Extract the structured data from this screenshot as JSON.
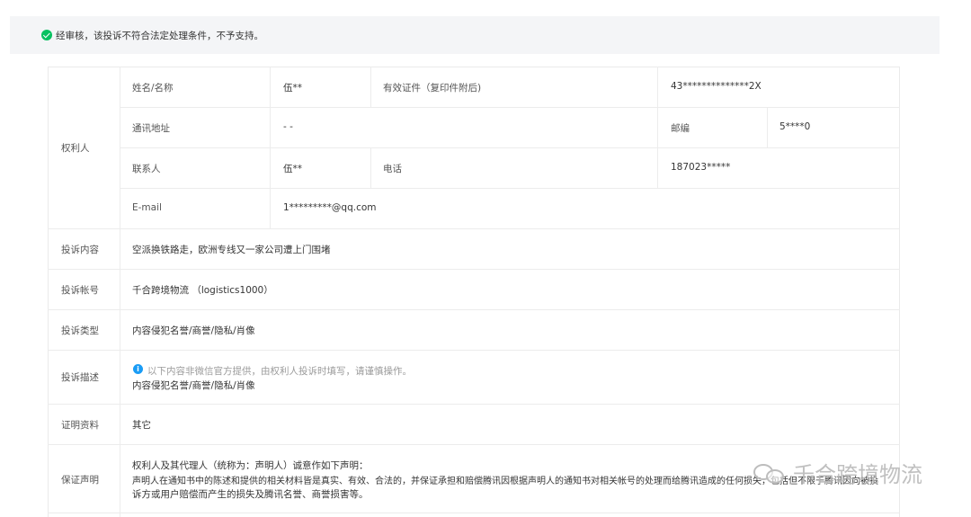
{
  "banner": {
    "message": "经审核，该投诉不符合法定处理条件，不予支持。"
  },
  "rights_holder": {
    "section_label": "权利人",
    "name_label": "姓名/名称",
    "name_value": "伍**",
    "id_label": "有效证件（复印件附后)",
    "id_value": "43**************2X",
    "address_label": "通讯地址",
    "address_value": "- -",
    "zip_label": "邮编",
    "zip_value": "5****0",
    "contact_label": "联系人",
    "contact_value": "伍**",
    "phone_label": "电话",
    "phone_value": "187023*****",
    "email_label": "E-mail",
    "email_value": "1*********@qq.com"
  },
  "complaint": {
    "content_label": "投诉内容",
    "content_value": "空派换铁路走，欧洲专线又一家公司遭上门围堵",
    "account_label": "投诉帐号",
    "account_value": "千合跨境物流 （logistics1000）",
    "type_label": "投诉类型",
    "type_value": "内容侵犯名誉/商誉/隐私/肖像",
    "desc_label": "投诉描述",
    "desc_note": "以下内容非微信官方提供，由权利人投诉时填写，请谨慎操作。",
    "desc_value": "内容侵犯名誉/商誉/隐私/肖像",
    "evidence_label": "证明资料",
    "evidence_value": "其它",
    "statement_label": "保证声明",
    "statement_line1": "权利人及其代理人（统称为：声明人）诚意作如下声明：",
    "statement_line2": "声明人在通知书中的陈述和提供的相关材料皆是真实、有效、合法的，并保证承担和赔偿腾讯因根据声明人的通知书对相关帐号的处理而给腾讯造成的任何损失，包括但不限于腾讯因向被投",
    "statement_line3": "诉方或用户赔偿而产生的损失及腾讯名誉、商誉损害等。"
  },
  "watermark": {
    "text": "千合跨境物流",
    "icon": "wechat-logo-icon"
  },
  "icons": {
    "banner": "check-circle-icon",
    "note": "info-icon"
  },
  "colors": {
    "success": "#07c160",
    "info": "#1a9cf5"
  }
}
